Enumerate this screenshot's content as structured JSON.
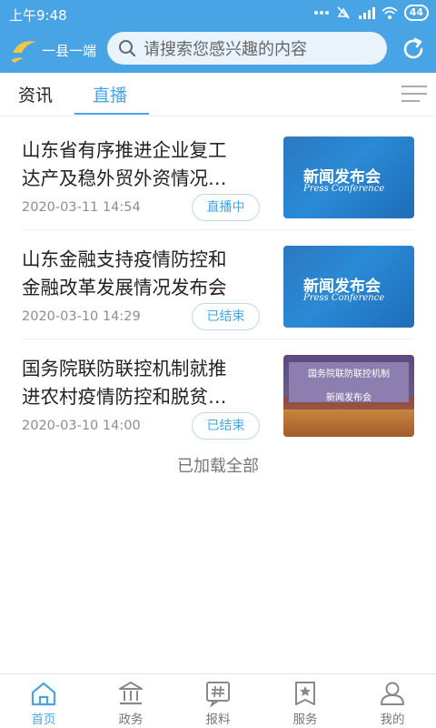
{
  "status": {
    "time": "上午9:48",
    "battery": "44"
  },
  "header": {
    "app_name": "一县一端",
    "search_placeholder": "请搜索您感兴趣的内容"
  },
  "tabs": [
    {
      "label": "资讯",
      "active": false
    },
    {
      "label": "直播",
      "active": true
    }
  ],
  "items": [
    {
      "title_line1": "山东省有序推进企业复工",
      "title_line2": "达产及稳外贸外资情况…",
      "date": "2020-03-11 14:54",
      "badge": "直播中",
      "thumb": {
        "line1": "新闻发布会",
        "line2": "Press Conference"
      }
    },
    {
      "title_line1": "山东金融支持疫情防控和",
      "title_line2": "金融改革发展情况发布会",
      "date": "2020-03-10 14:29",
      "badge": "已结束",
      "thumb": {
        "line1": "新闻发布会",
        "line2": "Press Conference"
      }
    },
    {
      "title_line1": "国务院联防联控机制就推",
      "title_line2": "进农村疫情防控和脱贫…",
      "date": "2020-03-10 14:00",
      "badge": "已结束",
      "thumb": {
        "line1": "国务院联防联控机制",
        "line2": "新闻发布会"
      }
    }
  ],
  "footer_text": "已加载全部",
  "bottom_nav": [
    {
      "label": "首页",
      "icon": "home-icon",
      "active": true
    },
    {
      "label": "政务",
      "icon": "government-building-icon",
      "active": false
    },
    {
      "label": "报料",
      "icon": "hashtag-icon",
      "active": false
    },
    {
      "label": "服务",
      "icon": "service-star-icon",
      "active": false
    },
    {
      "label": "我的",
      "icon": "user-icon",
      "active": false
    }
  ],
  "colors": {
    "accent": "#49a4e6",
    "text": "#222222",
    "muted": "#8d8d8d"
  }
}
